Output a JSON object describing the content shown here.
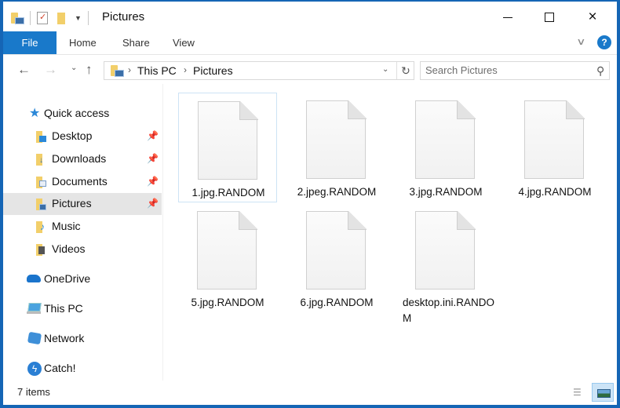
{
  "window": {
    "title": "Pictures",
    "controls": {
      "minimize": "minimize",
      "maximize": "maximize",
      "close": "×"
    }
  },
  "quick_access_toolbar": {
    "items": [
      "folder-icon",
      "properties-icon",
      "new-folder-icon",
      "customize-dropdown"
    ],
    "dropdown_glyph": "▼"
  },
  "ribbon": {
    "tabs": [
      {
        "label": "File",
        "active": true
      },
      {
        "label": "Home"
      },
      {
        "label": "Share"
      },
      {
        "label": "View"
      }
    ],
    "expand_glyph": "∨",
    "help_glyph": "?"
  },
  "navigation": {
    "back_glyph": "←",
    "forward_glyph": "→",
    "recent_glyph": "⌄",
    "up_glyph": "↑",
    "breadcrumb": [
      "This PC",
      "Pictures"
    ],
    "breadcrumb_sep": "›",
    "address_dropdown_glyph": "⌄",
    "refresh_glyph": "↻",
    "search_placeholder": "Search Pictures",
    "search_value": "",
    "search_glyph": "⚲"
  },
  "sidebar": {
    "items": [
      {
        "label": "Quick access",
        "icon": "star-icon"
      },
      {
        "label": "Desktop",
        "icon": "desktop-folder-icon",
        "pinned": true
      },
      {
        "label": "Downloads",
        "icon": "downloads-folder-icon",
        "pinned": true
      },
      {
        "label": "Documents",
        "icon": "documents-folder-icon",
        "pinned": true
      },
      {
        "label": "Pictures",
        "icon": "pictures-folder-icon",
        "pinned": true,
        "selected": true
      },
      {
        "label": "Music",
        "icon": "music-folder-icon"
      },
      {
        "label": "Videos",
        "icon": "videos-folder-icon"
      },
      {
        "label": "OneDrive",
        "icon": "onedrive-cloud-icon"
      },
      {
        "label": "This PC",
        "icon": "computer-icon"
      },
      {
        "label": "Network",
        "icon": "network-icon"
      },
      {
        "label": "Catch!",
        "icon": "catch-icon"
      }
    ],
    "pin_glyph": "📌"
  },
  "files": [
    {
      "name": "1.jpg.RANDOM",
      "focused": true
    },
    {
      "name": "2.jpeg.RANDOM"
    },
    {
      "name": "3.jpg.RANDOM"
    },
    {
      "name": "4.jpg.RANDOM"
    },
    {
      "name": "5.jpg.RANDOM"
    },
    {
      "name": "6.jpg.RANDOM"
    },
    {
      "name": "desktop.ini.RANDOM"
    }
  ],
  "status": {
    "item_count": "7 items",
    "view_details_glyph": "☰"
  },
  "colors": {
    "accent": "#1979ca",
    "window_border": "#1565b5",
    "selected_nav": "#e5e5e5",
    "folder": "#f2cf6a"
  }
}
